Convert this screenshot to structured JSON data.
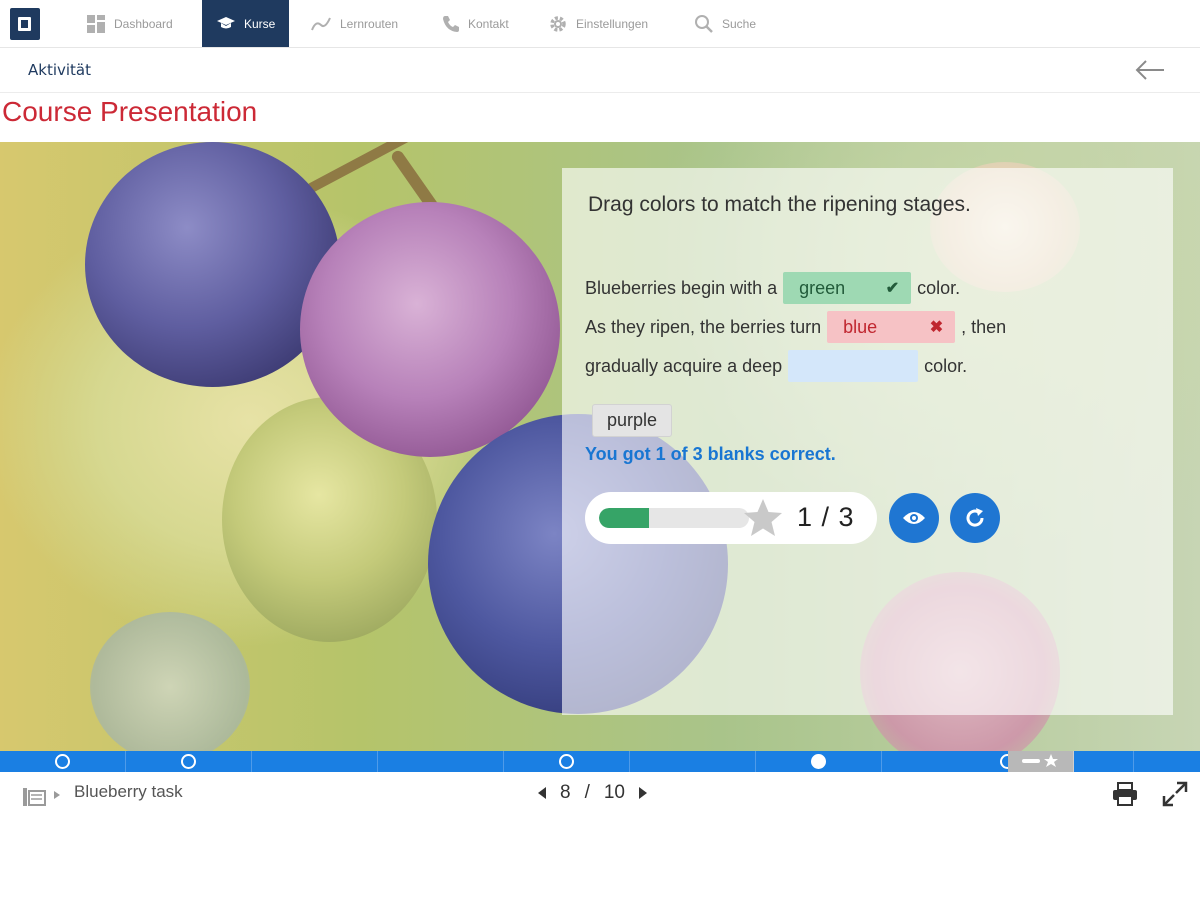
{
  "nav": {
    "items": [
      {
        "label": "Dashboard",
        "icon": "dashboard-icon"
      },
      {
        "label": "Kurse",
        "icon": "graduation-cap-icon",
        "active": true
      },
      {
        "label": "Lernrouten",
        "icon": "route-icon"
      },
      {
        "label": "Kontakt",
        "icon": "phone-icon"
      },
      {
        "label": "Einstellungen",
        "icon": "gear-icon"
      },
      {
        "label": "Suche",
        "icon": "search-icon"
      }
    ]
  },
  "subheader": {
    "title": "Aktivität"
  },
  "course": {
    "title": "Course Presentation"
  },
  "task": {
    "question": "Drag colors to match the ripening stages.",
    "line1": {
      "before": "Blueberries begin with a",
      "blank": "green",
      "blank_state": "correct",
      "after": "color."
    },
    "line2": {
      "before": "As they ripen, the berries turn",
      "blank": "blue",
      "blank_state": "wrong",
      "after": ", then"
    },
    "line3": {
      "before": "gradually acquire a deep",
      "blank": "",
      "blank_state": "empty",
      "after": "color."
    },
    "draggable_word": "purple",
    "feedback": "You got 1 of 3 blanks correct.",
    "score": {
      "text": "1 / 3",
      "fraction": 0.333
    },
    "buttons": [
      {
        "icon": "eye-icon"
      },
      {
        "icon": "retry-icon"
      }
    ]
  },
  "progress": {
    "total_slides": 10,
    "current_slide": 8,
    "markers": [
      "circle",
      "circle",
      "none",
      "none",
      "circle",
      "none",
      "filled",
      "circle",
      "summary"
    ]
  },
  "footer": {
    "task_name": "Blueberry task",
    "page_current": "8",
    "page_sep": "/",
    "page_total": "10"
  },
  "colors": {
    "nav_active": "#1f3a5f",
    "title_red": "#cc2936",
    "accent_blue": "#1f76d2",
    "correct_green": "#9ed9b3",
    "wrong_red": "#f6c2c5",
    "progress_blue": "#1a7fe3"
  }
}
